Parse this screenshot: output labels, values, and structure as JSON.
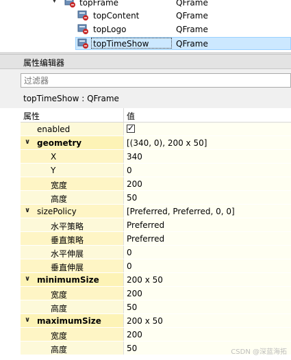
{
  "tree": {
    "rows": [
      {
        "name": "topFrame",
        "class": "QFrame"
      },
      {
        "name": "topContent",
        "class": "QFrame"
      },
      {
        "name": "topLogo",
        "class": "QFrame"
      },
      {
        "name": "topTimeShow",
        "class": "QFrame"
      }
    ]
  },
  "property_editor": {
    "title": "属性编辑器",
    "filter_placeholder": "过滤器",
    "object_label": "topTimeShow : QFrame",
    "header": {
      "property": "属性",
      "value": "值"
    },
    "rows": [
      {
        "name": "enabled",
        "value": "",
        "checked": true
      },
      {
        "name": "geometry",
        "value": "[(340, 0), 200 x 50]"
      },
      {
        "name": "X",
        "value": "340"
      },
      {
        "name": "Y",
        "value": "0"
      },
      {
        "name": "宽度",
        "value": "200"
      },
      {
        "name": "高度",
        "value": "50"
      },
      {
        "name": "sizePolicy",
        "value": "[Preferred, Preferred, 0, 0]"
      },
      {
        "name": "水平策略",
        "value": "Preferred"
      },
      {
        "name": "垂直策略",
        "value": "Preferred"
      },
      {
        "name": "水平伸展",
        "value": "0"
      },
      {
        "name": "垂直伸展",
        "value": "0"
      },
      {
        "name": "minimumSize",
        "value": "200 x 50"
      },
      {
        "name": "宽度",
        "value": "200"
      },
      {
        "name": "高度",
        "value": "50"
      },
      {
        "name": "maximumSize",
        "value": "200 x 50"
      },
      {
        "name": "宽度",
        "value": "200"
      },
      {
        "name": "高度",
        "value": "50"
      }
    ]
  },
  "watermark": "CSDN @深蓝海拓"
}
